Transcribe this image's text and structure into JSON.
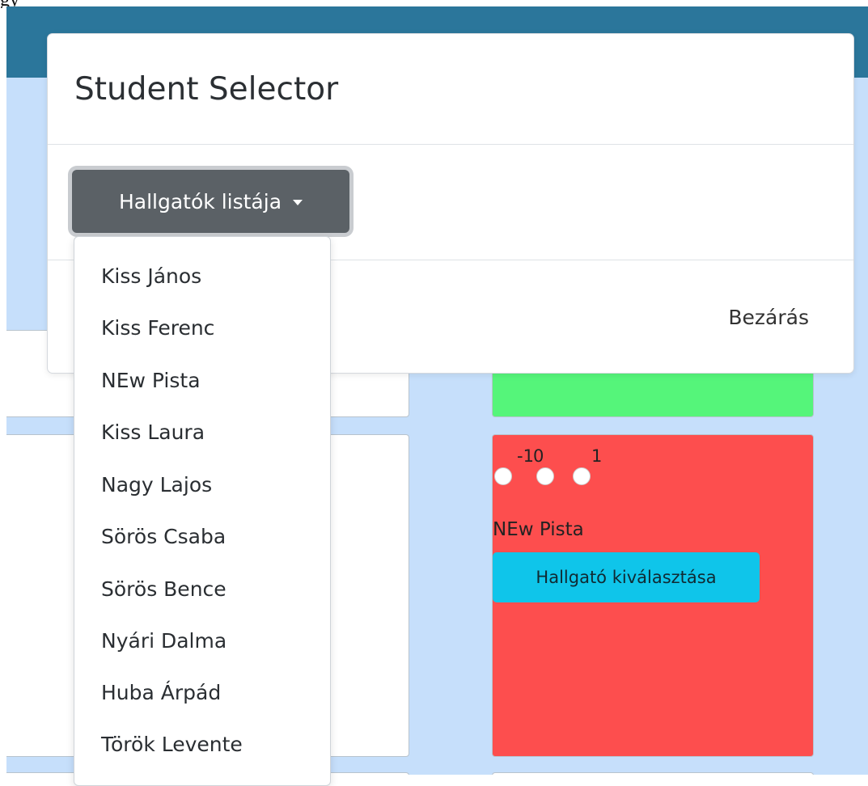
{
  "page": {
    "top_caption": "gy",
    "colors": {
      "navbar": "#2b769b",
      "background": "#c6dffb",
      "card_green": "#55f57a",
      "card_red": "#fd4e4e",
      "select_button": "#0fc5ea",
      "dropdown_button": "#5b6166"
    }
  },
  "modal": {
    "title": "Student Selector",
    "dropdown_label": "Hallgatók listája",
    "dropdown_icon": "caret-down-icon",
    "close_label": "Bezárás",
    "items": [
      "Kiss János",
      "Kiss Ferenc",
      "NEw Pista",
      "Kiss Laura",
      "Nagy Lajos",
      "Sörös Csaba",
      "Sörös Bence",
      "Nyári Dalma",
      "Huba Árpád",
      "Török Levente"
    ]
  },
  "student_card": {
    "rating_labels": [
      "-1",
      "0",
      "1"
    ],
    "name": "NEw Pista",
    "select_label": "Hallgató kiválasztása"
  }
}
